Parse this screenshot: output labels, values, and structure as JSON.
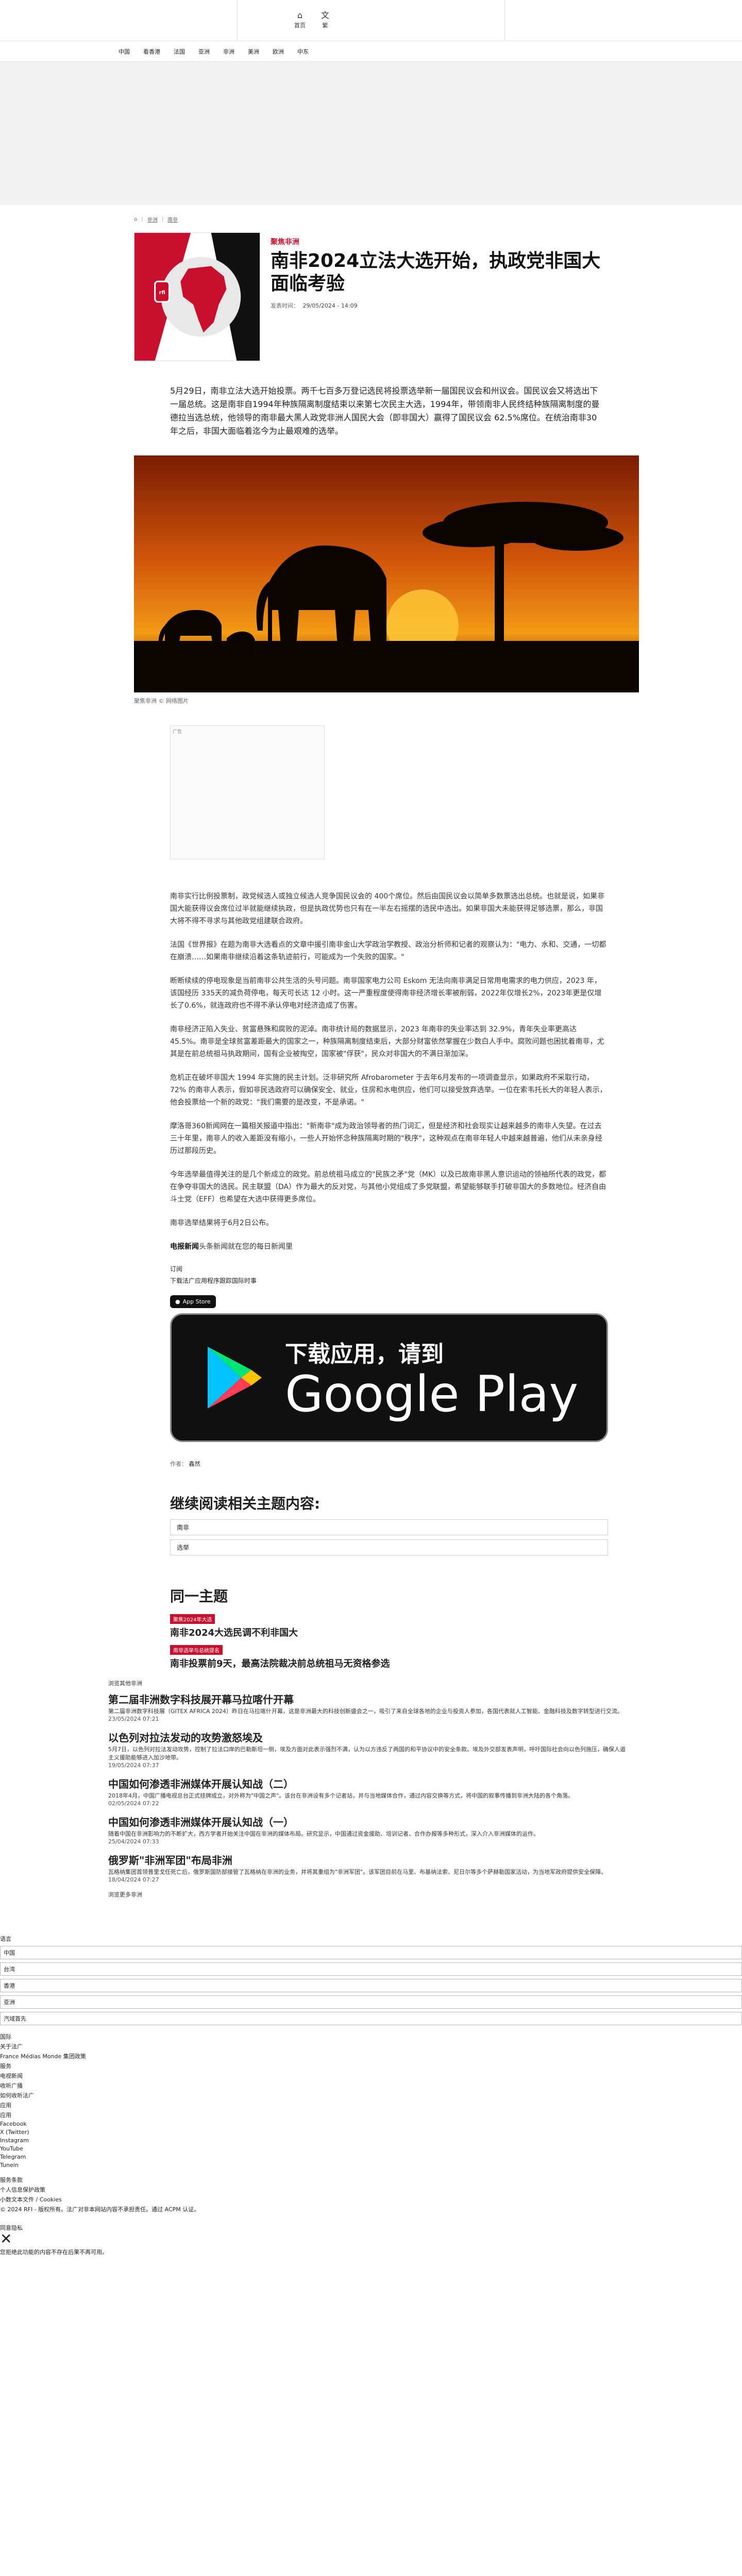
{
  "header": {
    "home_label": "首页",
    "lang_label": "繁"
  },
  "nav": {
    "items": [
      "中国",
      "看香港",
      "法国",
      "亚洲",
      "非洲",
      "美洲",
      "欧洲",
      "中东"
    ]
  },
  "breadcrumb": {
    "items": [
      "非洲",
      "南非"
    ]
  },
  "article": {
    "category": "聚焦非洲",
    "title": "南非2024立法大选开始，执政党非国大面临考验",
    "pub_label": "发表时间：",
    "pub_date": "29/05/2024 - 14:09",
    "lead": "5月29日，南非立法大选开始投票。两千七百多万登记选民将投票选举新一届国民议会和州议会。国民议会又将选出下一届总统。这是南非自1994年种族隔离制度结束以来第七次民主大选，1994年，带领南非人民终结种族隔离制度的曼德拉当选总统，他领导的南非最大黑人政党非洲人国民大会（即非国大）赢得了国民议会 62.5%席位。在统治南非30年之后，非国大面临着迄今为止最艰难的选举。",
    "caption": "聚焦非洲 © 网络图片",
    "ad_label": "广告",
    "paragraphs": [
      "南非实行比例投票制，政党候选人或独立候选人竞争国民议会的 400个席位。然后由国民议会以简单多数票选出总统。也就是说，如果非国大能获得议会席位过半就能继续执政，但是执政优势也只有在一半左右摇摆的选民中选出。如果非国大未能获得足够选票，那么，非国大将不得不寻求与其他政党组建联合政府。",
      "法国《世界报》在题为南非大选看点的文章中援引南非金山大学政治学教授、政治分析师和记者的观察认为：\"电力、水和、交通，一切都在崩溃……如果南非继续沿着这条轨迹前行，可能成为一个失败的国家。\"",
      "断断续续的停电现象是当前南非公共生活的头号问题。南非国家电力公司 Eskom 无法向南非满足日常用电需求的电力供应，2023 年，该国经历 335天的减负荷停电，每天可长达 12 小时。这一严重程度使得南非经济增长率被削弱，2022年仅增长2%，2023年更是仅增长了0.6%，就连政府也不得不承认停电对经济造成了伤害。",
      "南非经济正陷入失业、贫富悬殊和腐败的泥淖。南非统计局的数据显示，2023 年南非的失业率达到 32.9%，青年失业率更高达 45.5%。南非是全球贫富差距最大的国家之一，种族隔离制度结束后，大部分财富依然掌握在少数白人手中。腐败问题也困扰着南非，尤其是在前总统祖马执政期间，国有企业被掏空，国家被\"俘获\"，民众对非国大的不满日渐加深。",
      "危机正在破坏非国大 1994 年实施的民主计划。泛非研究所 Afrobarometer 于去年6月发布的一项调查显示，如果政府不采取行动，72% 的南非人表示，假如非民选政府可以确保安全、就业，住房和水电供应，他们可以接受放弃选举。一位在索韦托长大的年轻人表示，他会投票给一个新的政党：\"我们需要的是改变，不是承诺。\"",
      "摩洛哥360新闻网在一篇相关报道中指出：\"新南非\"成为政治领导者的热门词汇，但是经济和社会现实让越来越多的南非人失望。在过去三十年里，南非人的收入差距没有缩小，一些人开始怀念种族隔离时期的\"秩序\"，这种观点在南非年轻人中越来越普遍，他们从未亲身经历过那段历史。",
      "今年选举最值得关注的是几个新成立的政党。前总统祖马成立的\"民族之矛\"党（MK）以及已故南非黑人意识运动的领袖所代表的政党，都在争夺非国大的选民。民主联盟（DA）作为最大的反对党，与其他小党组成了多党联盟，希望能够联手打破非国大的多数地位。经济自由斗士党（EFF）也希望在大选中获得更多席位。",
      "南非选举结果将于6月2日公布。"
    ],
    "rfi_prefix": "电报新闻",
    "rfi_text": "头条新闻就在您的每日新闻里",
    "subscribe_label": "订阅",
    "download_label": "下载法广应用程序跟踪国际时事",
    "appstore_label": "App Store",
    "gplay_top": "下载应用，请到",
    "gplay_big": "Google Play",
    "author_label": "作者：",
    "author": "鑫然"
  },
  "related": {
    "title": "继续阅读相关主题内容:",
    "tags": [
      "南非",
      "选举"
    ]
  },
  "same_topic": {
    "title": "同一主题",
    "items": [
      {
        "badge": "聚焦2024年大选",
        "title": "南非2024大选民调不利非国大"
      },
      {
        "badge": "南非选举与总统提名",
        "title": "南非投票前9天，最高法院裁决前总统祖马无资格参选"
      }
    ]
  },
  "latest": {
    "section_label": "浏览其他非洲",
    "items": [
      {
        "title": "第二届非洲数字科技展开幕马拉喀什开幕",
        "desc": "第二届非洲数字科技展（GITEX AFRICA 2024）昨日在马拉喀什开幕，这是非洲最大的科技创新盛会之一，吸引了来自全球各地的企业与投资人参加，各国代表就人工智能、金融科技及数字转型进行交流。",
        "date": "23/05/2024 07:21"
      },
      {
        "title": "以色列对拉法发动的攻势激怒埃及",
        "desc": "5月7日，以色列对拉法发动攻势，控制了拉法口岸的巴勒斯坦一侧，埃及方面对此表示强烈不满，认为以方违反了两国的和平协议中的安全条款。埃及外交部发表声明，呼吁国际社会向以色列施压，确保人道主义援助能够进入加沙地带。",
        "date": "19/05/2024 07:37"
      },
      {
        "title": "中国如何渗透非洲媒体开展认知战（二）",
        "desc": "2018年4月，中国广播电视总台正式挂牌成立，对外称为\"中国之声\"。该台在非洲设有多个记者站，并与当地媒体合作，通过内容交换等方式，将中国的叙事传播到非洲大陆的各个角落。",
        "date": "02/05/2024 07:22"
      },
      {
        "title": "中国如何渗透非洲媒体开展认知战（一）",
        "desc": "随着中国在非洲影响力的不断扩大，西方学者开始关注中国在非洲的媒体布局。研究显示，中国通过资金援助、培训记者、合作办报等多种形式，深入介入非洲媒体的运作。",
        "date": "25/04/2024 07:33"
      },
      {
        "title": "俄罗斯\"非洲军团\"布局非洲",
        "desc": "瓦格纳集团首领普里戈任死亡后，俄罗斯国防部接管了瓦格纳在非洲的业务，并将其重组为\"非洲军团\"。该军团目前在马里、布基纳法索、尼日尔等多个萨赫勒国家活动，为当地军政府提供安全保障。",
        "date": "18/04/2024 07:27"
      }
    ],
    "more_label": "浏览更多非洲"
  },
  "footer": {
    "section_label": "语言",
    "languages": [
      "中国",
      "台湾",
      "香港",
      "亚洲",
      "汽域首先"
    ],
    "links": [
      "国际",
      "关于法广",
      "France Médias Monde 集团政策",
      "服务",
      "电视新闻",
      "收听广播",
      "如何收听法广",
      "应用",
      "应用",
      "Facebook",
      "X (Twitter)",
      "Instagram",
      "YouTube",
      "Telegram",
      "Tunein"
    ],
    "legal": [
      "服务条款",
      "个人信息保护政策",
      "小数文本文件 / Cookies"
    ],
    "copyright": "© 2024 RFI - 版权所有。法广对非本网站内容不承担责任。通过 ACPM 认证。",
    "cookie_label": "同意隐私",
    "cookie_text": "您拒绝此功能的内容不存在后果不再可用。"
  },
  "colors": {
    "accent": "#c8102e",
    "text": "#222222"
  }
}
